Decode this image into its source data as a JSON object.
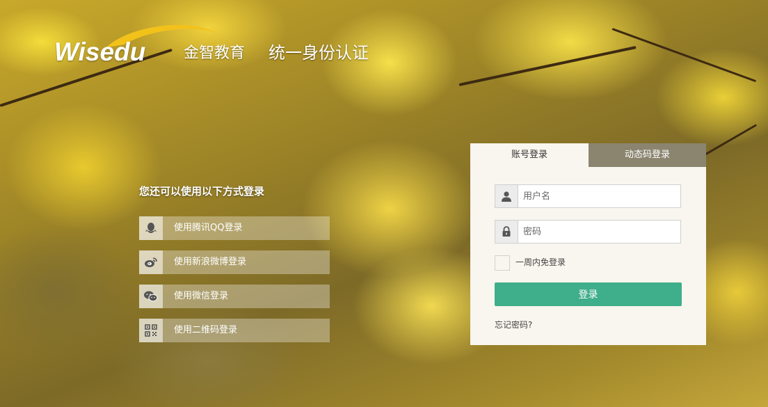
{
  "brand": {
    "logo_text": "Wisedu",
    "company_cn": "金智教育",
    "system_title": "统一身份认证"
  },
  "alt_login": {
    "title": "您还可以使用以下方式登录",
    "items": [
      {
        "label": "使用腾讯QQ登录",
        "icon": "qq-icon"
      },
      {
        "label": "使用新浪微博登录",
        "icon": "weibo-icon"
      },
      {
        "label": "使用微信登录",
        "icon": "wechat-icon"
      },
      {
        "label": "使用二维码登录",
        "icon": "qrcode-icon"
      }
    ]
  },
  "login_panel": {
    "tabs": [
      {
        "label": "账号登录",
        "active": true
      },
      {
        "label": "动态码登录",
        "active": false
      }
    ],
    "username": {
      "placeholder": "用户名",
      "value": "",
      "icon": "user-icon"
    },
    "password": {
      "placeholder": "密码",
      "value": "",
      "icon": "lock-icon"
    },
    "remember_label": "一周内免登录",
    "remember_checked": false,
    "submit_label": "登录",
    "forgot_label": "忘记密码?"
  },
  "colors": {
    "accent": "#3fae8a",
    "inactive_tab": "#8b8570",
    "panel_bg": "#f8f6ee"
  }
}
